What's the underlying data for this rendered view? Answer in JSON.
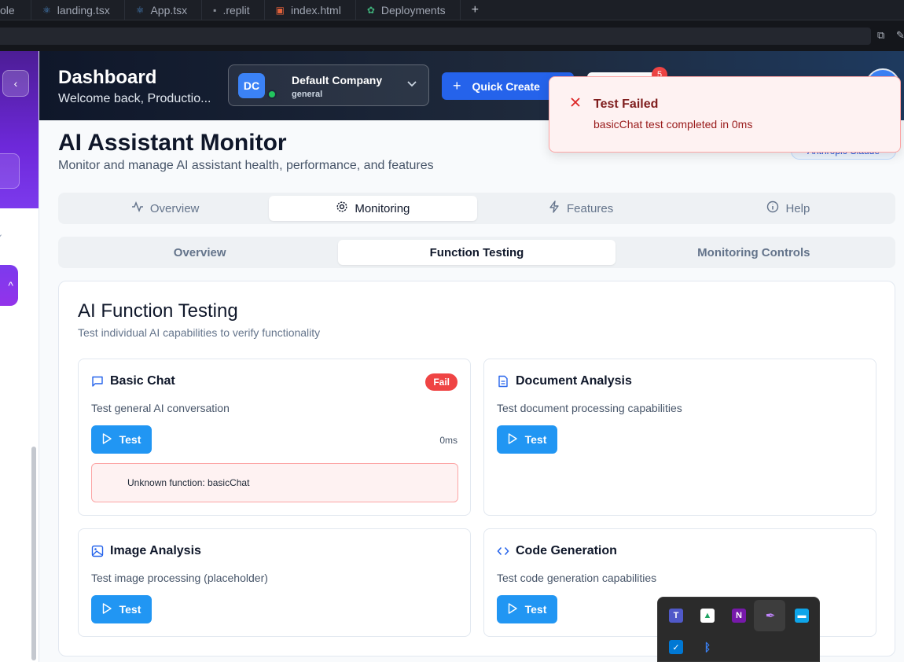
{
  "editor": {
    "tabs": [
      {
        "label": "ole",
        "icon": ""
      },
      {
        "label": "landing.tsx",
        "icon": "react-icon"
      },
      {
        "label": "App.tsx",
        "icon": "react-icon"
      },
      {
        "label": ".replit",
        "icon": "replit-icon"
      },
      {
        "label": "index.html",
        "icon": "html-icon"
      },
      {
        "label": "Deployments",
        "icon": "deploy-icon"
      }
    ],
    "new_tab": "+"
  },
  "header": {
    "title": "Dashboard",
    "subtitle": "Welcome back, Productio...",
    "company": {
      "initials": "DC",
      "name": "Default Company",
      "role": "general"
    },
    "quick_create": "Quick Create",
    "notifications_count": "5"
  },
  "page": {
    "title": "AI Assistant Monitor",
    "subtitle": "Monitor and manage AI assistant health, performance, and features",
    "model_badge": "Anthropic Claude"
  },
  "main_tabs": [
    {
      "label": "Overview",
      "icon": "activity-icon",
      "active": false
    },
    {
      "label": "Monitoring",
      "icon": "gear-icon",
      "active": true
    },
    {
      "label": "Features",
      "icon": "zap-icon",
      "active": false
    },
    {
      "label": "Help",
      "icon": "info-icon",
      "active": false
    }
  ],
  "sub_tabs": [
    {
      "label": "Overview",
      "active": false
    },
    {
      "label": "Function Testing",
      "active": true
    },
    {
      "label": "Monitoring Controls",
      "active": false
    }
  ],
  "panel": {
    "title": "AI Function Testing",
    "subtitle": "Test individual AI capabilities to verify functionality"
  },
  "cards": [
    {
      "title": "Basic Chat",
      "description": "Test general AI conversation",
      "button": "Test",
      "status": "Fail",
      "duration": "0ms",
      "error": "Unknown function: basicChat",
      "icon": "message-square-icon"
    },
    {
      "title": "Document Analysis",
      "description": "Test document processing capabilities",
      "button": "Test",
      "icon": "file-text-icon"
    },
    {
      "title": "Image Analysis",
      "description": "Test image processing (placeholder)",
      "button": "Test",
      "icon": "image-icon"
    },
    {
      "title": "Code Generation",
      "description": "Test code generation capabilities",
      "button": "Test",
      "icon": "code-icon"
    }
  ],
  "toast": {
    "title": "Test Failed",
    "description": "basicChat test completed in 0ms"
  },
  "colors": {
    "primary": "#2563eb",
    "test_button": "#2196f3",
    "fail": "#ef4444",
    "toast_bg": "#fef2f2"
  }
}
